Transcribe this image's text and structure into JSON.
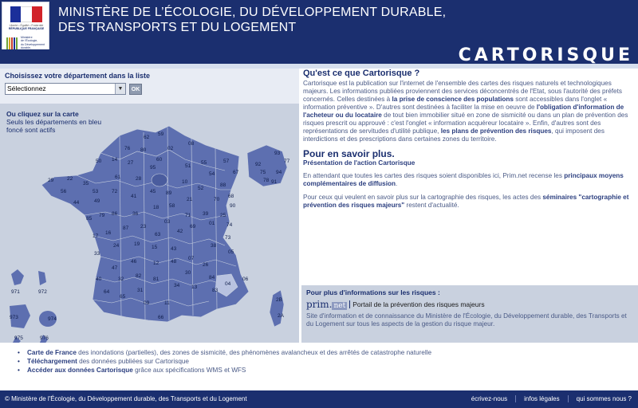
{
  "header": {
    "logo": {
      "republic": "RÉPUBLIQUE FRANÇAISE",
      "motto": "Liberté • Égalité • Fraternité",
      "ministry_lines": [
        "Ministère",
        "de l'Écologie,",
        "du Développement",
        "durable,",
        "des Transports",
        "et du Logement"
      ]
    },
    "ministry_line1": "MINISTÈRE DE L’ÉCOLOGIE, DU DÉVELOPPEMENT DURABLE,",
    "ministry_line2": "DES TRANSPORTS ET DU LOGEMENT",
    "brand": "CARTORISQUE"
  },
  "colors": {
    "navy": "#1b2f6f",
    "map_fill": "#5d6fb0",
    "map_bg": "#c9d1df",
    "panel_bg": "#e8ecf4",
    "highlight_dept": "#b8c2e0"
  },
  "department_selector": {
    "label": "Choisissez votre département dans la liste",
    "selected": "Sélectionnez",
    "button": "OK"
  },
  "map": {
    "caption_title": "Ou cliquez sur la carte",
    "caption_text": "Seuls les départements en bleu foncé sont actifs",
    "numbers": [
      {
        "n": "62"
      },
      {
        "n": "59"
      },
      {
        "n": "80"
      },
      {
        "n": "76"
      },
      {
        "n": "02"
      },
      {
        "n": "08"
      },
      {
        "n": "50"
      },
      {
        "n": "14"
      },
      {
        "n": "27"
      },
      {
        "n": "60"
      },
      {
        "n": "95"
      },
      {
        "n": "51"
      },
      {
        "n": "55"
      },
      {
        "n": "57"
      },
      {
        "n": "54"
      },
      {
        "n": "67"
      },
      {
        "n": "29"
      },
      {
        "n": "22"
      },
      {
        "n": "56"
      },
      {
        "n": "35"
      },
      {
        "n": "53"
      },
      {
        "n": "61"
      },
      {
        "n": "28"
      },
      {
        "n": "45"
      },
      {
        "n": "10"
      },
      {
        "n": "52"
      },
      {
        "n": "88"
      },
      {
        "n": "68"
      },
      {
        "n": "44"
      },
      {
        "n": "49"
      },
      {
        "n": "72"
      },
      {
        "n": "41"
      },
      {
        "n": "89"
      },
      {
        "n": "21"
      },
      {
        "n": "70"
      },
      {
        "n": "90"
      },
      {
        "n": "85"
      },
      {
        "n": "79"
      },
      {
        "n": "86"
      },
      {
        "n": "36"
      },
      {
        "n": "18"
      },
      {
        "n": "58"
      },
      {
        "n": "71"
      },
      {
        "n": "39"
      },
      {
        "n": "25"
      },
      {
        "n": "17"
      },
      {
        "n": "16"
      },
      {
        "n": "87"
      },
      {
        "n": "23"
      },
      {
        "n": "03"
      },
      {
        "n": "63"
      },
      {
        "n": "42"
      },
      {
        "n": "69"
      },
      {
        "n": "01"
      },
      {
        "n": "74"
      },
      {
        "n": "73"
      },
      {
        "n": "33"
      },
      {
        "n": "24"
      },
      {
        "n": "19"
      },
      {
        "n": "15"
      },
      {
        "n": "43"
      },
      {
        "n": "07"
      },
      {
        "n": "38"
      },
      {
        "n": "05"
      },
      {
        "n": "40"
      },
      {
        "n": "47"
      },
      {
        "n": "46"
      },
      {
        "n": "12"
      },
      {
        "n": "48"
      },
      {
        "n": "30"
      },
      {
        "n": "26"
      },
      {
        "n": "84"
      },
      {
        "n": "04"
      },
      {
        "n": "06"
      },
      {
        "n": "64"
      },
      {
        "n": "65"
      },
      {
        "n": "32"
      },
      {
        "n": "82"
      },
      {
        "n": "81"
      },
      {
        "n": "31"
      },
      {
        "n": "34"
      },
      {
        "n": "13"
      },
      {
        "n": "83"
      },
      {
        "n": "09"
      },
      {
        "n": "11"
      },
      {
        "n": "66"
      },
      {
        "n": "2B"
      },
      {
        "n": "2A"
      },
      {
        "n": "93"
      },
      {
        "n": "92"
      },
      {
        "n": "75"
      },
      {
        "n": "94"
      },
      {
        "n": "77"
      },
      {
        "n": "78"
      },
      {
        "n": "91"
      },
      {
        "n": "971"
      },
      {
        "n": "972"
      },
      {
        "n": "973"
      },
      {
        "n": "974"
      },
      {
        "n": "975"
      },
      {
        "n": "976"
      }
    ]
  },
  "intro": {
    "title": "Qu'est ce que Cartorisque ?",
    "p1_a": "Cartorisque est la publication sur l'internet de l'ensemble des cartes des risques naturels et technologiques majeurs. Les informations publiées proviennent des services déconcentrés de l'Etat, sous l'autorité des préfets concernés. Celles destinées à ",
    "p1_b": "la prise de conscience des populations",
    "p1_c": " sont accessibles dans l'onglet « information préventive ». D'autres sont destinées à faciliter la mise en oeuvre de ",
    "p1_d": "l'obligation d'information de l'acheteur ou du locataire",
    "p1_e": " de tout bien immobilier situé en zone de sismicité ou dans un plan de prévention des risques prescrit ou approuvé : c'est l'onglet « information acquéreur locataire ». Enfin, d'autres sont des représentations de servitudes d'utilité publique, ",
    "p1_f": "les plans de prévention des risques",
    "p1_g": ", qui imposent des interdictions et des prescriptions dans certaines zones du territoire."
  },
  "more": {
    "title": "Pour en savoir plus.",
    "presentation_link": "Présentation de l'action Cartorisque",
    "p2_a": "En attendant que toutes les cartes des risques soient disponibles ici, Prim.net recense les ",
    "p2_b": "principaux moyens complémentaires de diffusion",
    "p2_c": ".",
    "p3_a": "Pour ceux qui veulent en savoir plus sur la cartographie des risques, les actes des ",
    "p3_b": "séminaires \"cartographie et prévention des risques majeurs\"",
    "p3_c": " restent d'actualité."
  },
  "info_box": {
    "title": "Pour plus d'informations sur les risques :",
    "logo_prim": "prim.",
    "logo_net": "net",
    "portal": "Portail de la prévention des risques majeurs",
    "text": "Site d'information et de connaissance du Ministère de l'Écologie, du Développement durable, des Transports et du Logement sur tous les aspects de la gestion du risque majeur."
  },
  "bottom_links": [
    {
      "bold": "Carte de France",
      "rest": " des inondations (partielles), des zones de sismicité, des phénomènes avalancheux et des arrêtés de catastrophe naturelle"
    },
    {
      "bold": "Téléchargement",
      "rest": " des données publiées sur Cartorisque"
    },
    {
      "bold": "Accéder aux données Cartorisque",
      "rest": " grâce aux spécifications WMS et WFS"
    }
  ],
  "footer": {
    "copyright": "© Ministère de l'Écologie, du Développement durable, des Transports et du Logement",
    "links": [
      "écrivez-nous",
      "infos légales",
      "qui sommes nous ?"
    ]
  }
}
